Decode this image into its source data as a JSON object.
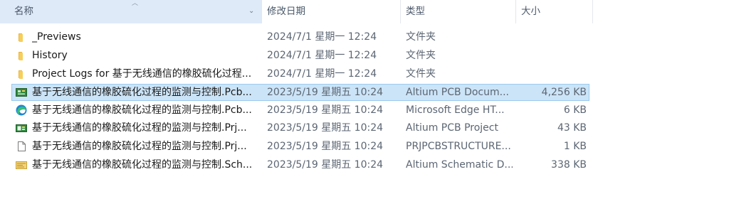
{
  "columns": {
    "name": "名称",
    "date": "修改日期",
    "type": "类型",
    "size": "大小"
  },
  "files": [
    {
      "name": "_Previews",
      "date": "2024/7/1 星期一 12:24",
      "type": "文件夹",
      "size": "",
      "icon": "folder-icon"
    },
    {
      "name": "History",
      "date": "2024/7/1 星期一 12:24",
      "type": "文件夹",
      "size": "",
      "icon": "folder-icon"
    },
    {
      "name": "Project Logs for 基于无线通信的橡胶硫化过程...",
      "date": "2024/7/1 星期一 12:24",
      "type": "文件夹",
      "size": "",
      "icon": "folder-icon"
    },
    {
      "name": "基于无线通信的橡胶硫化过程的监测与控制.Pcb...",
      "date": "2023/5/19 星期五 10:24",
      "type": "Altium PCB Docum...",
      "size": "4,256 KB",
      "icon": "altium-pcb-doc-icon",
      "selected": true
    },
    {
      "name": "基于无线通信的橡胶硫化过程的监测与控制.Pcb...",
      "date": "2023/5/19 星期五 10:24",
      "type": "Microsoft Edge HT...",
      "size": "6 KB",
      "icon": "edge-icon"
    },
    {
      "name": "基于无线通信的橡胶硫化过程的监测与控制.Prj...",
      "date": "2023/5/19 星期五 10:24",
      "type": "Altium PCB Project",
      "size": "43 KB",
      "icon": "altium-project-icon"
    },
    {
      "name": "基于无线通信的橡胶硫化过程的监测与控制.Prj...",
      "date": "2023/5/19 星期五 10:24",
      "type": "PRJPCBSTRUCTURE...",
      "size": "1 KB",
      "icon": "generic-file-icon"
    },
    {
      "name": "基于无线通信的橡胶硫化过程的监测与控制.Sch...",
      "date": "2023/5/19 星期五 10:24",
      "type": "Altium Schematic D...",
      "size": "338 KB",
      "icon": "altium-schematic-icon"
    }
  ],
  "colors": {
    "selection_bg": "#cce4f7",
    "selection_border": "#99c9ef",
    "folder": "#f4c542"
  }
}
